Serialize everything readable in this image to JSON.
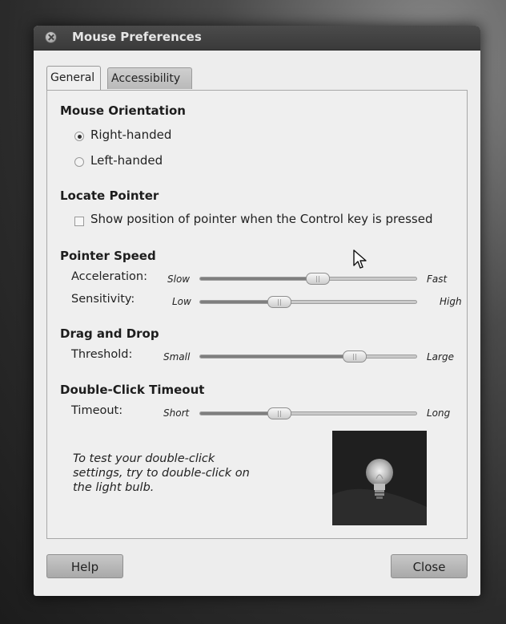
{
  "window": {
    "title": "Mouse Preferences"
  },
  "tabs": [
    {
      "label": "General",
      "selected": true
    },
    {
      "label": "Accessibility",
      "selected": false
    }
  ],
  "orientation": {
    "heading": "Mouse Orientation",
    "options": [
      {
        "label": "Right-handed",
        "selected": true
      },
      {
        "label": "Left-handed",
        "selected": false
      }
    ]
  },
  "locate": {
    "heading": "Locate Pointer",
    "checkbox_label": "Show position of pointer when the Control key is pressed",
    "checked": false
  },
  "speed": {
    "heading": "Pointer Speed",
    "acceleration": {
      "label": "Acceleration:",
      "min": "Slow",
      "max": "Fast",
      "value": 0.55
    },
    "sensitivity": {
      "label": "Sensitivity:",
      "min": "Low",
      "max": "High",
      "value": 0.35
    }
  },
  "drag": {
    "heading": "Drag and Drop",
    "threshold": {
      "label": "Threshold:",
      "min": "Small",
      "max": "Large",
      "value": 0.74
    }
  },
  "doubleclick": {
    "heading": "Double-Click Timeout",
    "timeout": {
      "label": "Timeout:",
      "min": "Short",
      "max": "Long",
      "value": 0.35
    },
    "hint": "To test your double-click settings, try to double-click on the light bulb."
  },
  "buttons": {
    "help": "Help",
    "close": "Close"
  },
  "colors": {
    "titlebar": "#3f3f3f",
    "window_bg": "#ededed",
    "accent_fill": "#7e7e7e"
  }
}
